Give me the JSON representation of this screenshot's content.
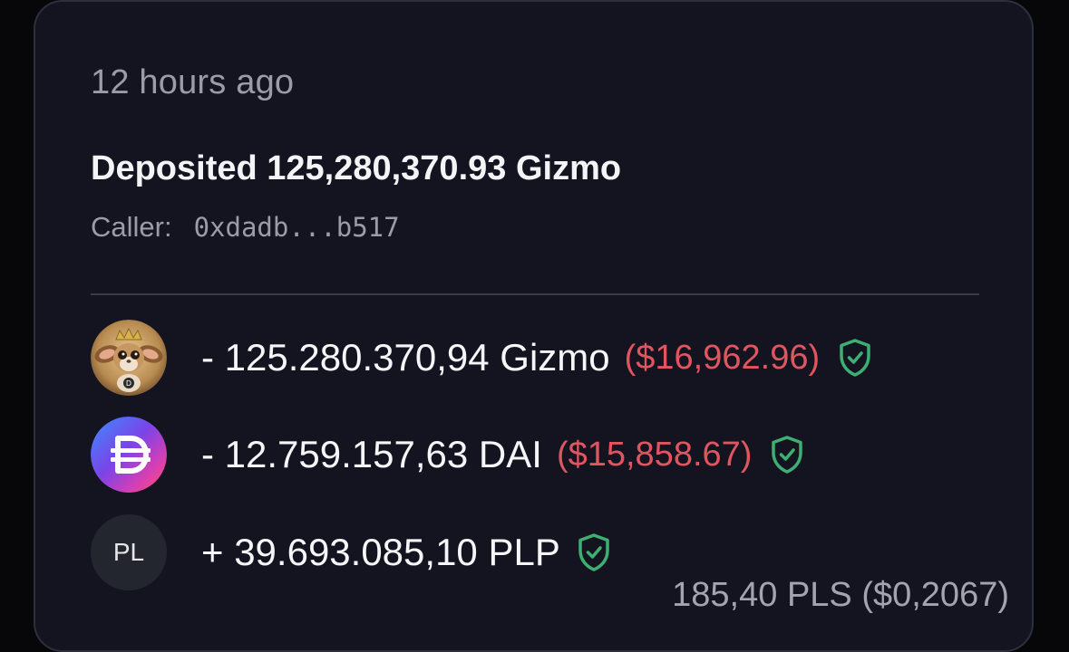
{
  "activity": {
    "time_ago": "12 hours ago",
    "title": "Deposited 125,280,370.93 Gizmo",
    "caller_label": "Caller:",
    "caller_address": "0xdadb...b517"
  },
  "transfers": [
    {
      "icon": "gizmo-token-icon",
      "amount": "- 125.280.370,94 Gizmo",
      "usd": "($16,962.96)",
      "verified": true
    },
    {
      "icon": "dai-token-icon",
      "amount": "- 12.759.157,63 DAI",
      "usd": "($15,858.67)",
      "verified": true
    },
    {
      "icon": "pl-token-icon",
      "icon_text": "PL",
      "amount": "+ 39.693.085,10 PLP",
      "verified": true
    }
  ],
  "fee": {
    "value": "185,40 PLS ($0,2067)"
  },
  "colors": {
    "background": "#070709",
    "card": "#131420",
    "negative": "#e0555f",
    "verified": "#3fae73"
  }
}
